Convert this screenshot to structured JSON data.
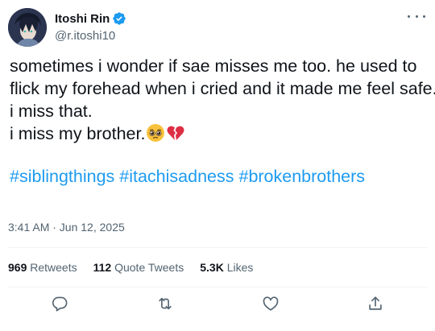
{
  "author": {
    "display_name": "Itoshi Rin",
    "handle": "@r.itoshi10",
    "verified_icon": "verified-badge-icon",
    "avatar_icon": "avatar-icon"
  },
  "tweet": {
    "lines": [
      "sometimes i wonder if sae misses me too. he used to",
      "flick my forehead when i cried and it made me feel safe.",
      "i miss that.",
      "i miss my brother."
    ],
    "emojis": [
      "pleading-face-emoji",
      "broken-heart-emoji"
    ],
    "hashtags": [
      "#siblingthings",
      "#itachisadness",
      "#brokenbrothers"
    ],
    "timestamp": "3:41 AM · Jun 12, 2025"
  },
  "stats": {
    "retweets_count": "969",
    "retweets_label": "Retweets",
    "quote_count": "112",
    "quote_label": "Quote Tweets",
    "likes_count": "5.3K",
    "likes_label": "Likes"
  },
  "actions": [
    "reply-icon",
    "retweet-icon",
    "like-icon",
    "share-icon"
  ],
  "colors": {
    "accent": "#1d9bf0",
    "text": "#0f1419",
    "muted": "#536471",
    "divider": "#eff3f4"
  }
}
